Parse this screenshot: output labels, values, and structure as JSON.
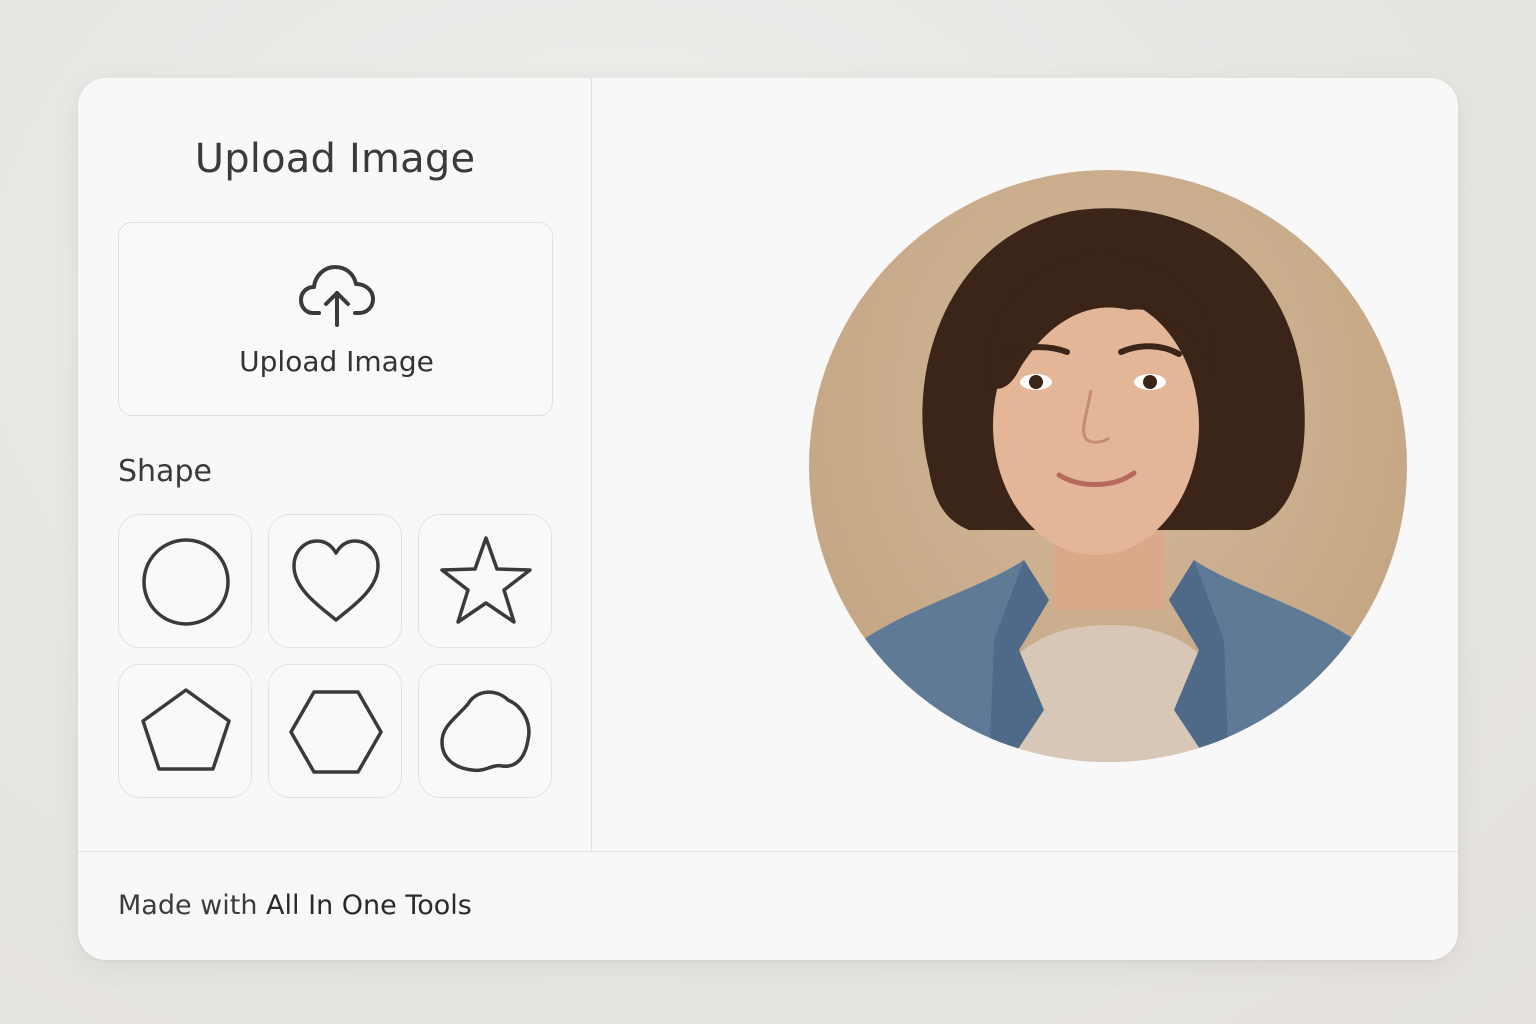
{
  "panel": {
    "title": "Upload Image"
  },
  "upload": {
    "label": "Upload Image",
    "icon": "cloud-upload-icon"
  },
  "shapes": {
    "label": "Shape",
    "options": [
      {
        "name": "circle",
        "icon": "circle-icon"
      },
      {
        "name": "heart",
        "icon": "heart-icon"
      },
      {
        "name": "star",
        "icon": "star-icon"
      },
      {
        "name": "pentagon",
        "icon": "pentagon-icon"
      },
      {
        "name": "hexagon",
        "icon": "hexagon-icon"
      },
      {
        "name": "blob",
        "icon": "blob-icon"
      }
    ]
  },
  "preview": {
    "shape": "circle",
    "subject": "portrait photo"
  },
  "footer": {
    "prefix": "Made with ",
    "brand": "All In One Tools"
  },
  "colors": {
    "icon_stroke": "#3a3a3a",
    "card_bg": "#f8f8f8",
    "photo_bg": "#c9ac8b"
  }
}
